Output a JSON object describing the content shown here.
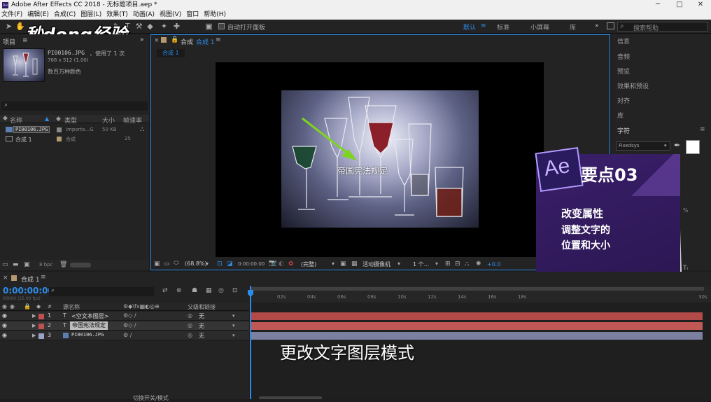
{
  "window": {
    "title": "Adobe After Effects CC 2018 - 无标题项目.aep *",
    "minimize": "─",
    "maximize": "□",
    "close": "✕"
  },
  "menu": [
    "文件(F)",
    "编辑(E)",
    "合成(C)",
    "图层(L)",
    "效果(T)",
    "动画(A)",
    "视图(V)",
    "窗口",
    "帮助(H)"
  ],
  "toolbar": {
    "auto_open_label": "自动打开面板",
    "workspaces": [
      "默认",
      "标准",
      "小屏幕",
      "库"
    ],
    "more": "»",
    "search_placeholder": "搜索帮助"
  },
  "watermark": "秒dong经验",
  "project": {
    "tab_label": "项目",
    "menu_icon": "≡",
    "footage_name": "PI00106.JPG",
    "footage_used": "，使用了 1 次",
    "footage_size": "768 x 512 (1.00)",
    "footage_colors": "数百万种颜色",
    "columns": [
      "名称",
      "类型",
      "大小",
      "帧速率"
    ],
    "items": [
      {
        "name": "PI00106.JPG",
        "type": "Importe...G",
        "size": "50 KB",
        "rate": ""
      },
      {
        "name": "合成 1",
        "type": "合成",
        "size": "",
        "rate": "25"
      }
    ],
    "bpc": "8 bpc"
  },
  "composition": {
    "tab_label": "合成",
    "comp_name": "合成 1",
    "sub_tab": "合成 1",
    "overlay_text": "帝国宪法规定",
    "zoom": "(68.8%)",
    "timecode": "0:00:00:00",
    "quality": "(完整)",
    "camera": "活动摄像机",
    "views": "1 个...",
    "exposure": "+0.0"
  },
  "right_panel": {
    "items": [
      "信息",
      "音频",
      "预览",
      "效果和预设",
      "对齐",
      "库",
      "字符"
    ],
    "font": "Fixedsys",
    "units": "%",
    "tracking_icon": "Tᵢ"
  },
  "callout": {
    "logo": "Ae",
    "title": "要点03",
    "line1": "改变属性",
    "line2": "调整文字的",
    "line3": "位置和大小"
  },
  "timeline": {
    "tab_label": "合成 1",
    "timecode": "0:00:00:00",
    "timecode_sub": "00000 (25.00 fps)",
    "search_placeholder": "",
    "col_source": "源名称",
    "col_parent": "父级和链接",
    "ruler": [
      "02s",
      "04s",
      "06s",
      "08s",
      "10s",
      "12s",
      "14s",
      "16s",
      "18s",
      "30s"
    ],
    "layers": [
      {
        "num": "1",
        "type": "T",
        "name": "<空文本图层>",
        "parent": "无",
        "color": "#c0504d"
      },
      {
        "num": "2",
        "type": "T",
        "name": "帝国宪法规定",
        "parent": "无",
        "color": "#c0504d"
      },
      {
        "num": "3",
        "type": "img",
        "name": "PI00106.JPG",
        "parent": "无",
        "color": "#9aa0c8"
      }
    ],
    "toggle_label": "切换开关/模式"
  },
  "subtitle": "更改文字图层模式",
  "colors": {
    "accent": "#2d8ceb",
    "callout_purple": "#4a2a7a",
    "layer_red": "#b44a48",
    "arrow_green": "#7ed321"
  }
}
